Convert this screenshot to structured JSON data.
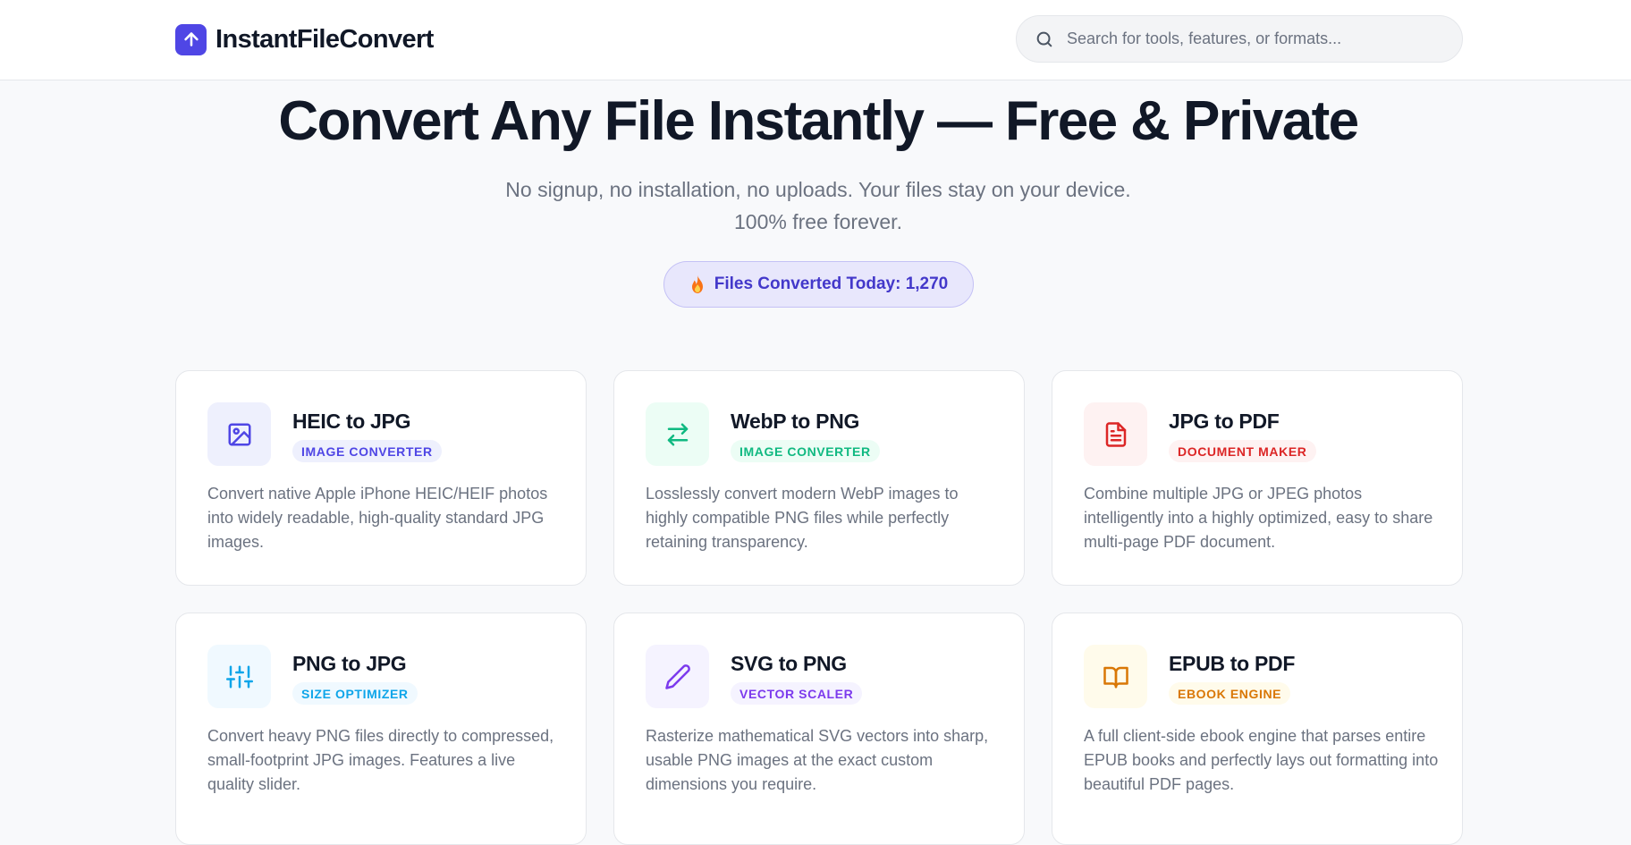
{
  "header": {
    "logo_text": "InstantFileConvert",
    "search_placeholder": "Search for tools, features, or formats..."
  },
  "hero": {
    "title": "Convert Any File Instantly — Free & Private",
    "subtitle_line1": "No signup, no installation, no uploads. Your files stay on your device.",
    "subtitle_line2": "100% free forever.",
    "counter_label": "Files Converted Today: 1,270"
  },
  "colors": {
    "brand": "#4f46e5",
    "image_converter": "#4f46e5",
    "image_converter_alt": "#10b981",
    "document_maker": "#dc2626",
    "size_optimizer": "#0ea5e9",
    "vector_scaler": "#7c3aed",
    "ebook_engine": "#d97706"
  },
  "tools": [
    {
      "title": "HEIC to JPG",
      "tag": "IMAGE CONVERTER",
      "icon": "image-icon",
      "description": "Convert native Apple iPhone HEIC/HEIF photos into widely readable, high-quality standard JPG images."
    },
    {
      "title": "WebP to PNG",
      "tag": "IMAGE CONVERTER",
      "icon": "swap-arrows-icon",
      "description": "Losslessly convert modern WebP images to highly compatible PNG files while perfectly retaining transparency."
    },
    {
      "title": "JPG to PDF",
      "tag": "DOCUMENT MAKER",
      "icon": "document-icon",
      "description": "Combine multiple JPG or JPEG photos intelligently into a highly optimized, easy to share multi-page PDF document."
    },
    {
      "title": "PNG to JPG",
      "tag": "SIZE OPTIMIZER",
      "icon": "sliders-icon",
      "description": "Convert heavy PNG files directly to compressed, small-footprint JPG images. Features a live quality slider."
    },
    {
      "title": "SVG to PNG",
      "tag": "VECTOR SCALER",
      "icon": "pencil-icon",
      "description": "Rasterize mathematical SVG vectors into sharp, usable PNG images at the exact custom dimensions you require."
    },
    {
      "title": "EPUB to PDF",
      "tag": "EBOOK ENGINE",
      "icon": "book-icon",
      "description": "A full client-side ebook engine that parses entire EPUB books and perfectly lays out formatting into beautiful PDF pages."
    }
  ]
}
